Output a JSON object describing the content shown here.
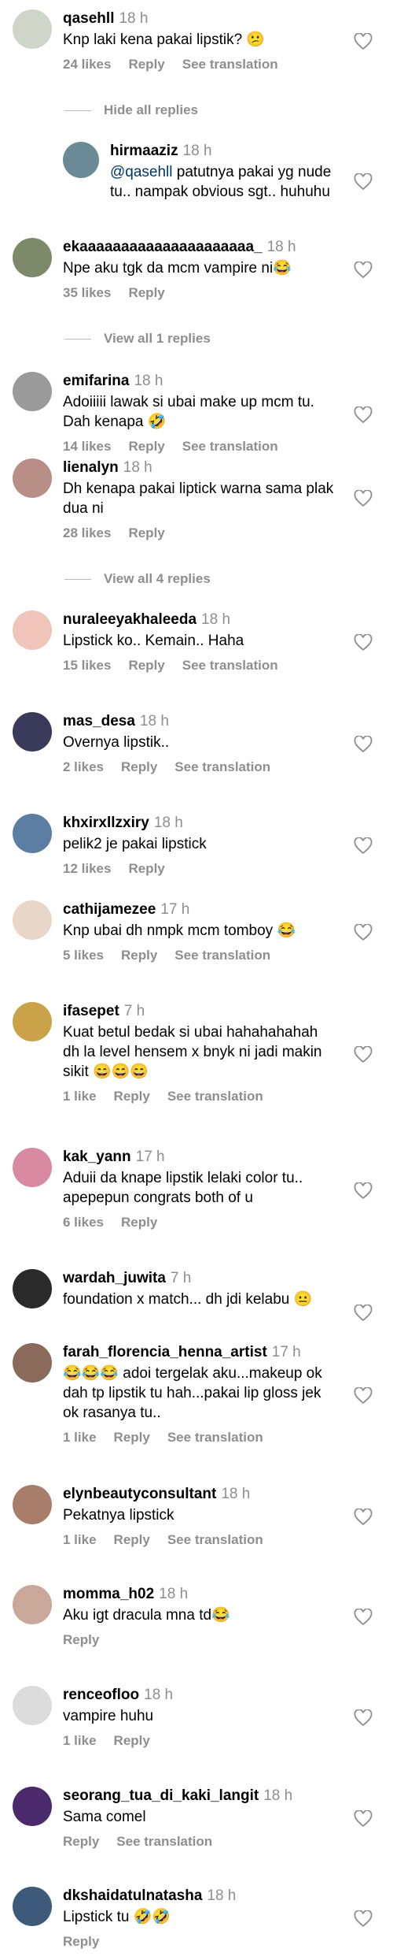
{
  "comments": [
    {
      "username": "qasehll",
      "time": "18 h",
      "text": "Knp laki kena pakai lipstik?",
      "emoji": "😕",
      "likes": "24 likes",
      "reply": "Reply",
      "translate": "See translation",
      "avatar_color": "#cfd6c9"
    },
    {
      "thread": "Hide all replies"
    },
    {
      "username": "hirmaaziz",
      "time": "18 h",
      "mention": "@qasehll",
      "text": " patutnya pakai yg nude tu.. nampak obvious sgt.. huhuhu",
      "avatar_color": "#6a8a95"
    },
    {
      "username": "ekaaaaaaaaaaaaaaaaaaaaa_",
      "time": "18 h",
      "text": "Npe aku tgk da mcm vampire ni",
      "emoji": "😂",
      "likes": "35 likes",
      "reply": "Reply",
      "avatar_color": "#7d8a6a"
    },
    {
      "thread": "View all 1 replies"
    },
    {
      "username": "emifarina",
      "time": "18 h",
      "text": "Adoiiiii lawak si ubai make up mcm tu. Dah kenapa",
      "emoji": "🤣",
      "likes": "14 likes",
      "reply": "Reply",
      "translate": "See translation",
      "avatar_color": "#9a9a9a"
    },
    {
      "username": "lienalyn",
      "time": "18 h",
      "text": "Dh kenapa pakai liptick warna sama plak dua ni",
      "likes": "28 likes",
      "reply": "Reply",
      "avatar_color": "#b78f87"
    },
    {
      "thread": "View all 4 replies"
    },
    {
      "username": "nuraleeyakhaleeda",
      "time": "18 h",
      "text": "Lipstick ko.. Kemain.. Haha",
      "likes": "15 likes",
      "reply": "Reply",
      "translate": "See translation",
      "avatar_color": "#f0c4b8"
    },
    {
      "username": "mas_desa",
      "time": "18 h",
      "text": "Overnya lipstik..",
      "likes": "2 likes",
      "reply": "Reply",
      "translate": "See translation",
      "avatar_color": "#3a3a5a"
    },
    {
      "username": "khxirxllzxiry",
      "time": "18 h",
      "text": "pelik2 je pakai lipstick",
      "likes": "12 likes",
      "reply": "Reply",
      "avatar_color": "#5d7ea3"
    },
    {
      "username": "cathijamezee",
      "time": "17 h",
      "text": "Knp ubai dh nmpk mcm tomboy",
      "emoji": "😂",
      "likes": "5 likes",
      "reply": "Reply",
      "translate": "See translation",
      "avatar_color": "#e8d6c8"
    },
    {
      "username": "ifasepet",
      "time": "7 h",
      "text": "Kuat betul bedak si ubai hahahahahah dh la level hensem x bnyk ni jadi makin sikit",
      "emoji": "😄😄😄",
      "likes": "1 like",
      "reply": "Reply",
      "translate": "See translation",
      "avatar_color": "#c9a24a"
    },
    {
      "username": "kak_yann",
      "time": "17 h",
      "text": "Aduii da knape lipstik lelaki color tu.. apepepun congrats both of u",
      "likes": "6 likes",
      "reply": "Reply",
      "avatar_color": "#d98aa3"
    },
    {
      "username": "wardah_juwita",
      "time": "7 h",
      "text": "foundation x match... dh jdi kelabu",
      "emoji": "😐",
      "avatar_color": "#2a2a2a"
    },
    {
      "username": "farah_florencia_henna_artist",
      "time": "17 h",
      "emoji_pre": "😂😂😂",
      "text": " adoi tergelak aku...makeup ok dah tp lipstik tu hah...pakai lip gloss jek ok rasanya tu..",
      "likes": "1 like",
      "reply": "Reply",
      "translate": "See translation",
      "avatar_color": "#8a6a5a"
    },
    {
      "username": "elynbeautyconsultant",
      "time": "18 h",
      "text": "Pekatnya lipstick",
      "likes": "1 like",
      "reply": "Reply",
      "translate": "See translation",
      "avatar_color": "#a87d6a"
    },
    {
      "username": "momma_h02",
      "time": "18 h",
      "text": "Aku igt dracula mna td",
      "emoji": "😂",
      "reply": "Reply",
      "avatar_color": "#c9a89a"
    },
    {
      "username": "renceofloo",
      "time": "18 h",
      "text": "vampire huhu",
      "likes": "1 like",
      "reply": "Reply",
      "avatar_color": "#dcdcdc"
    },
    {
      "username": "seorang_tua_di_kaki_langit",
      "time": "18 h",
      "text": "Sama comel",
      "reply": "Reply",
      "translate": "See translation",
      "avatar_color": "#4a2a6a"
    },
    {
      "username": "dkshaidatulnatasha",
      "time": "18 h",
      "text": "Lipstick tu",
      "emoji": "🤣🤣",
      "reply": "Reply",
      "avatar_color": "#3d5a7a"
    }
  ]
}
